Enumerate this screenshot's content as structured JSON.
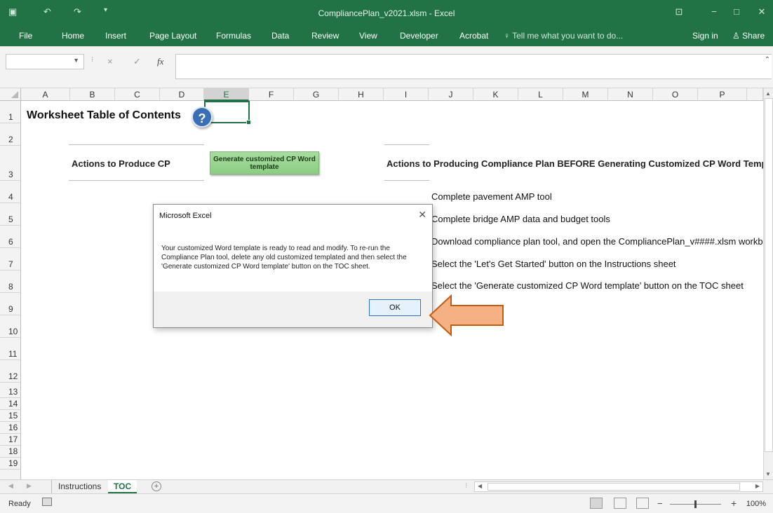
{
  "window": {
    "title": "CompliancePlan_v2021.xlsm - Excel",
    "qat_icons": [
      "save-icon",
      "undo-icon",
      "redo-icon",
      "customize-qat-icon"
    ],
    "controls": [
      "ribbon-display-icon",
      "minimize-icon",
      "maximize-icon",
      "close-icon"
    ],
    "accent_color": "#217346"
  },
  "ribbon": {
    "tabs": [
      "File",
      "Home",
      "Insert",
      "Page Layout",
      "Formulas",
      "Data",
      "Review",
      "View",
      "Developer",
      "Acrobat"
    ],
    "tell_me": "Tell me what you want to do...",
    "sign_in": "Sign in",
    "share": "Share"
  },
  "formula_bar": {
    "name_box": "",
    "cancel": "×",
    "enter": "✓",
    "fx": "fx",
    "value": ""
  },
  "grid": {
    "columns": [
      "A",
      "B",
      "C",
      "D",
      "E",
      "F",
      "G",
      "H",
      "I",
      "J",
      "K",
      "L",
      "M",
      "N",
      "O",
      "P"
    ],
    "selected_column": "E",
    "rows": [
      "1",
      "2",
      "3",
      "4",
      "5",
      "6",
      "7",
      "8",
      "9",
      "10",
      "11",
      "12",
      "13",
      "14",
      "15",
      "16",
      "17",
      "18",
      "19"
    ]
  },
  "sheet": {
    "title": "Worksheet Table of Contents",
    "help_button": "?",
    "actions_header": "Actions to Produce CP",
    "generate_button": "Generate customized CP Word template",
    "before_header": "Actions to Producing Compliance Plan BEFORE Generating Customized CP Word Template",
    "steps": [
      "Complete pavement AMP tool",
      "Complete bridge AMP data and budget tools",
      "Download compliance plan tool, and open the CompliancePlan_v####.xlsm workbo",
      "Select the 'Let's Get Started' button on the Instructions sheet",
      "Select the 'Generate customized CP Word template' button on the TOC sheet"
    ]
  },
  "dialog": {
    "title": "Microsoft Excel",
    "message": "Your customized Word template is ready to read and modify. To re-run the Compliance Plan tool, delete any old customized templated and then select the 'Generate customized CP Word template' button on the TOC sheet.",
    "ok": "OK"
  },
  "sheet_tabs": {
    "tabs": [
      "Instructions",
      "TOC"
    ],
    "active": "TOC",
    "add": "+"
  },
  "status_bar": {
    "status": "Ready",
    "zoom": "100%",
    "zoom_minus": "−",
    "zoom_plus": "+"
  }
}
